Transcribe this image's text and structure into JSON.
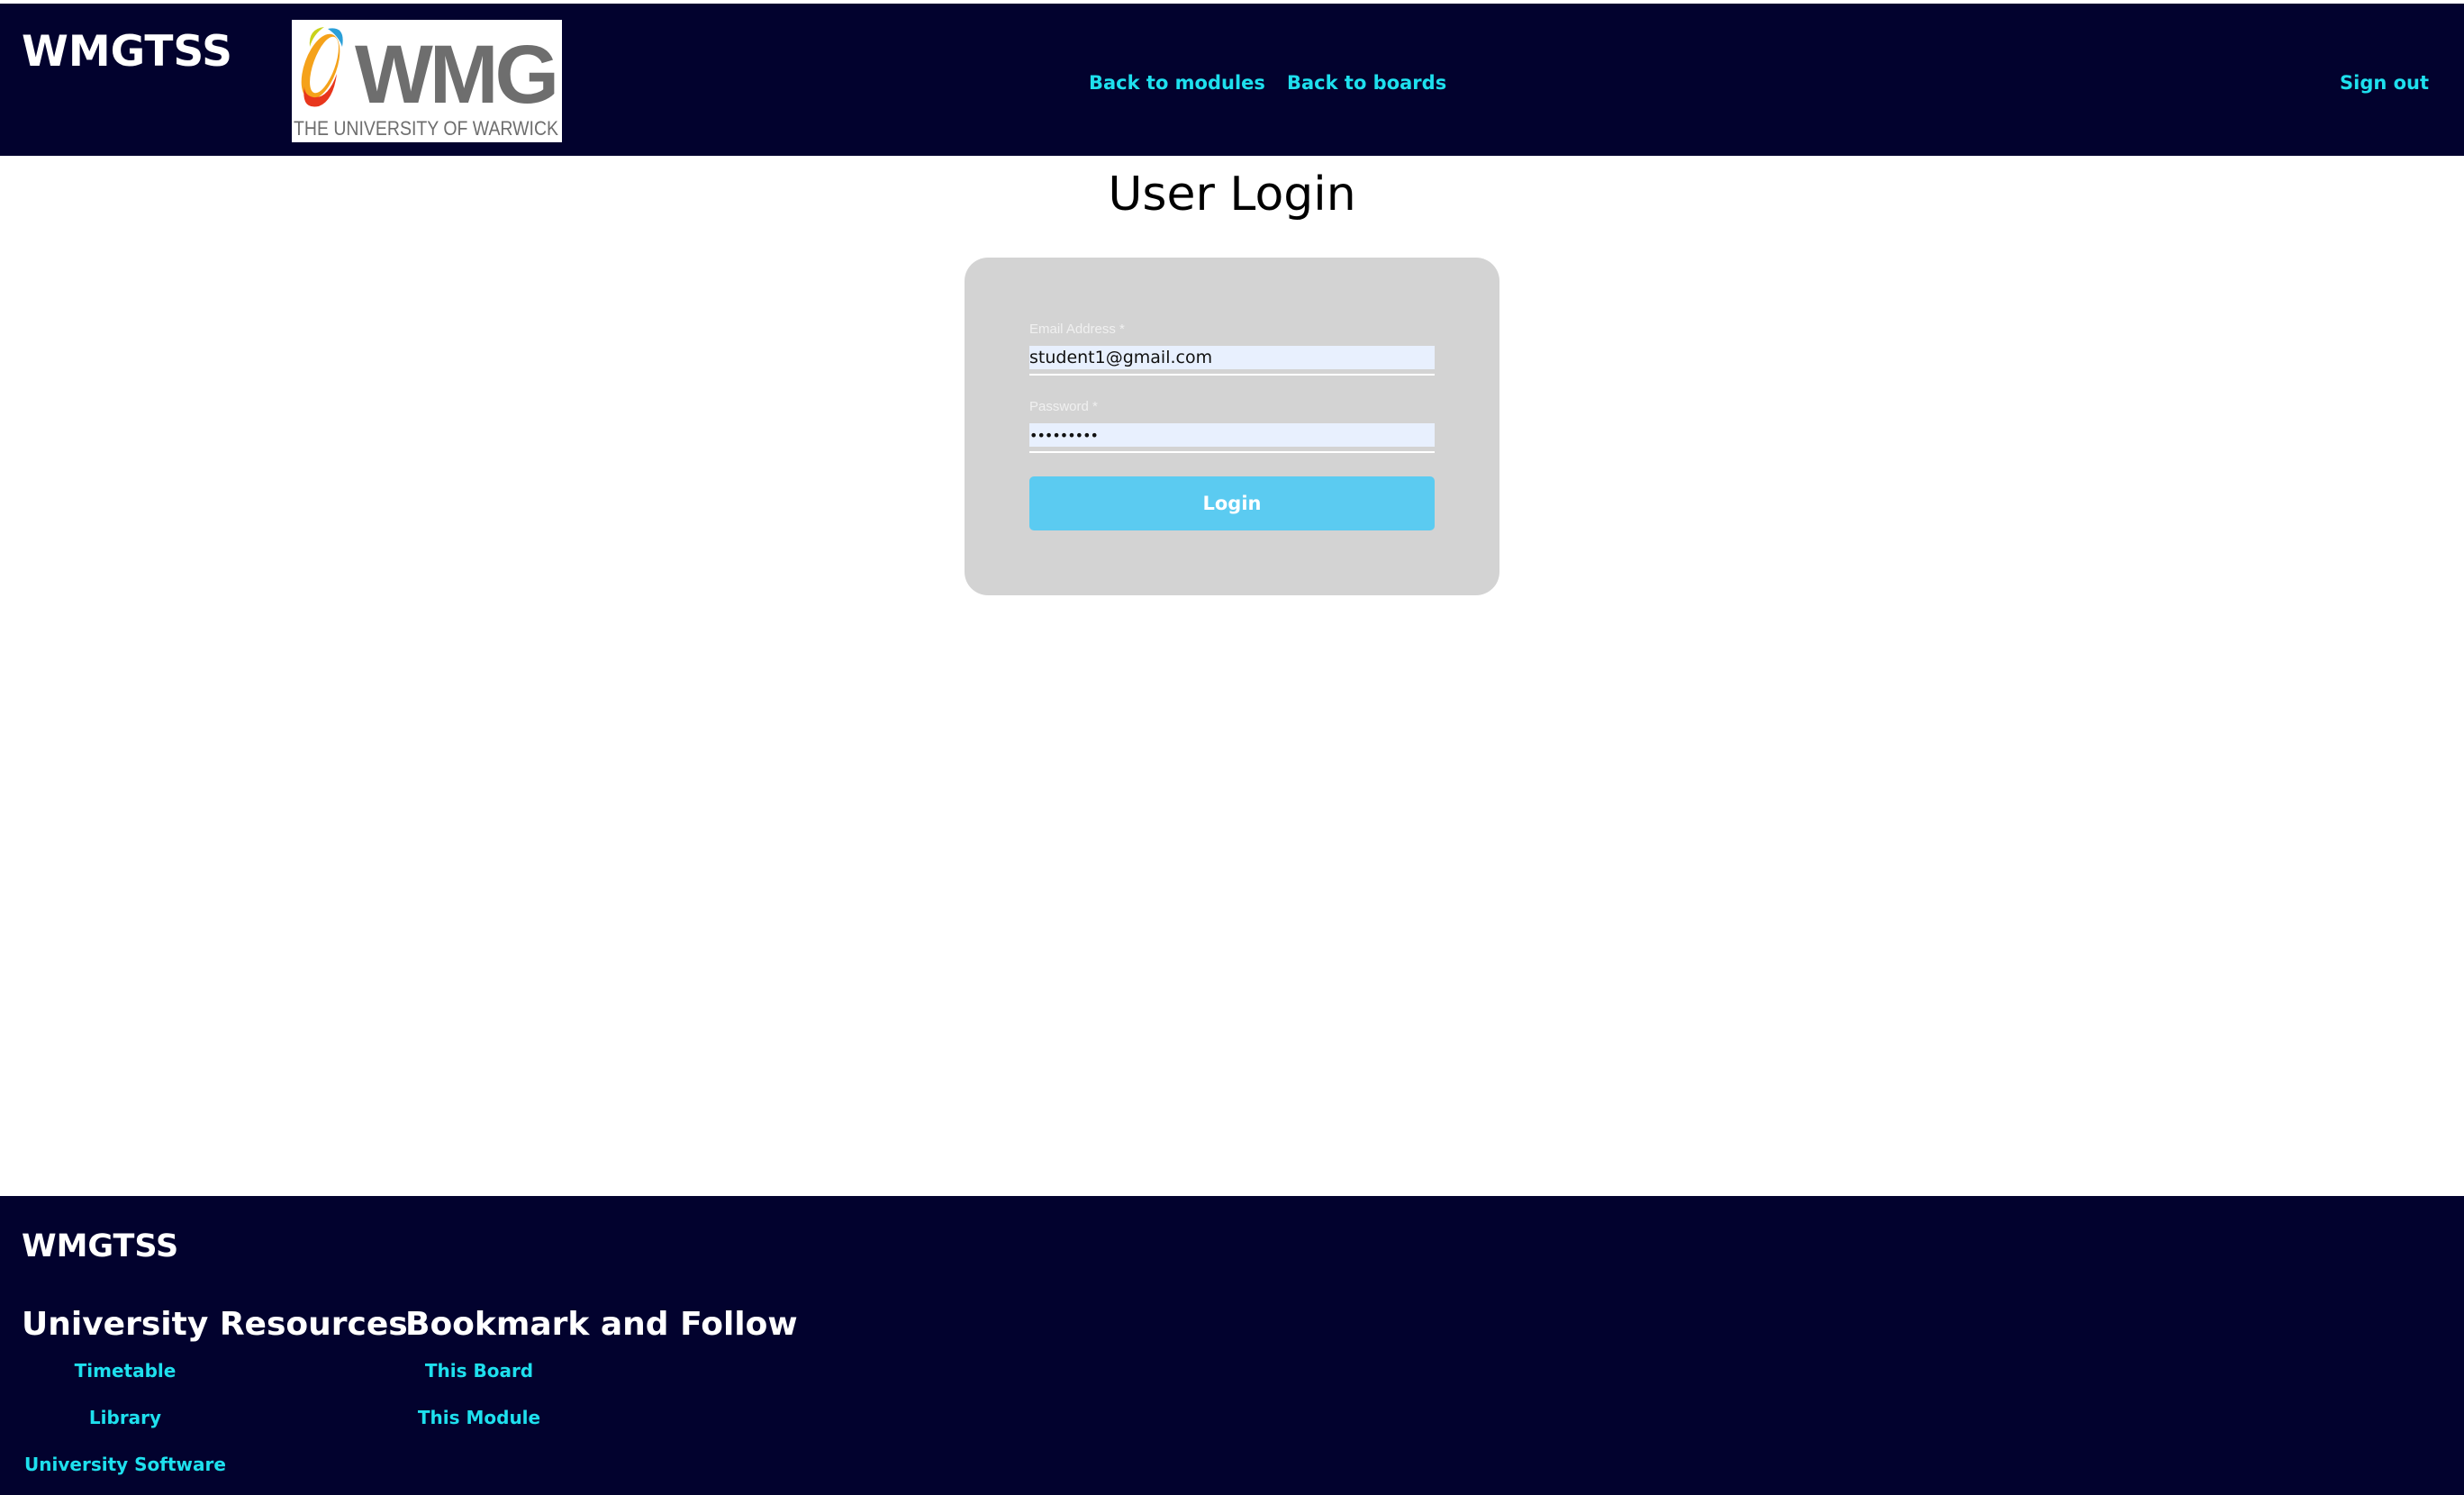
{
  "header": {
    "brand": "WMGTSS",
    "logo": {
      "text": "WMG",
      "subtext": "THE UNIVERSITY OF WARWICK"
    },
    "nav": {
      "back_to_modules": "Back to modules",
      "back_to_boards": "Back to boards",
      "sign_out": "Sign out"
    }
  },
  "main": {
    "title": "User Login",
    "form": {
      "email_label": "Email Address *",
      "email_value": "student1@gmail.com",
      "password_label": "Password *",
      "password_value": "studentpw",
      "login_label": "Login"
    }
  },
  "footer": {
    "brand": "WMGTSS",
    "resources": {
      "heading": "University Resources",
      "links": [
        "Timetable",
        "Library",
        "University Software"
      ]
    },
    "bookmark": {
      "heading": "Bookmark and Follow",
      "links": [
        "This Board",
        "This Module"
      ]
    }
  },
  "colors": {
    "header_bg": "#02022e",
    "link": "#1ee0ee",
    "card_bg": "#d3d3d3",
    "button_bg": "#5bcbf1",
    "input_bg": "#e8f0fe"
  }
}
